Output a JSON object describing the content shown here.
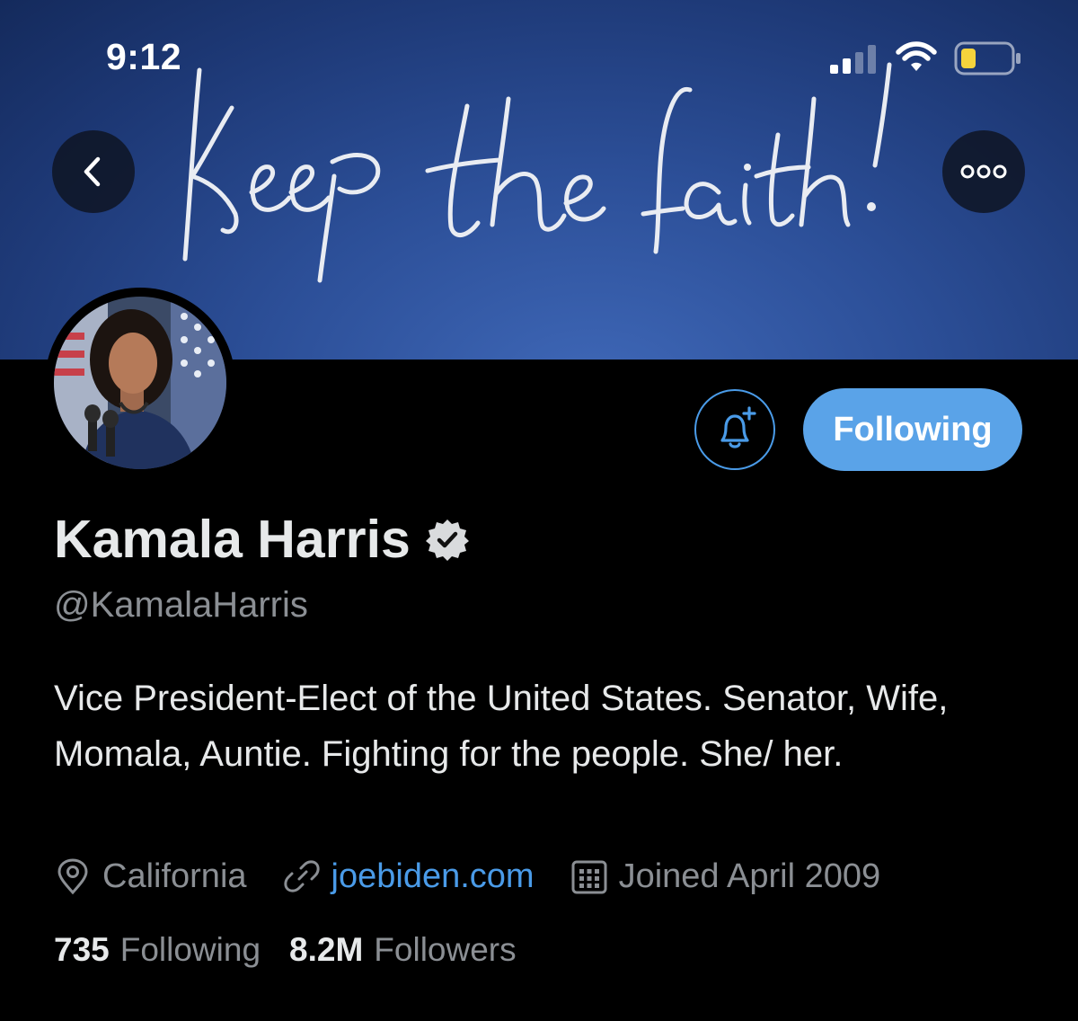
{
  "status_bar": {
    "time": "9:12"
  },
  "header": {
    "banner_script": "Keep the faith!",
    "accent_color": "#5aa3e8",
    "back_icon": "chevron-left-icon",
    "more_icon": "ellipsis-icon"
  },
  "profile": {
    "name": "Kamala Harris",
    "handle": "@KamalaHarris",
    "verified": true,
    "bio": "Vice President-Elect of the United States. Senator, Wife, Momala, Auntie. Fighting for the people. She/ her.",
    "location": "California",
    "website": "joebiden.com",
    "joined": "Joined April 2009",
    "following_count": "735",
    "following_label": "Following",
    "followers_count": "8.2M",
    "followers_label": "Followers"
  },
  "actions": {
    "notify_icon": "bell-plus-icon",
    "follow_state_label": "Following"
  }
}
